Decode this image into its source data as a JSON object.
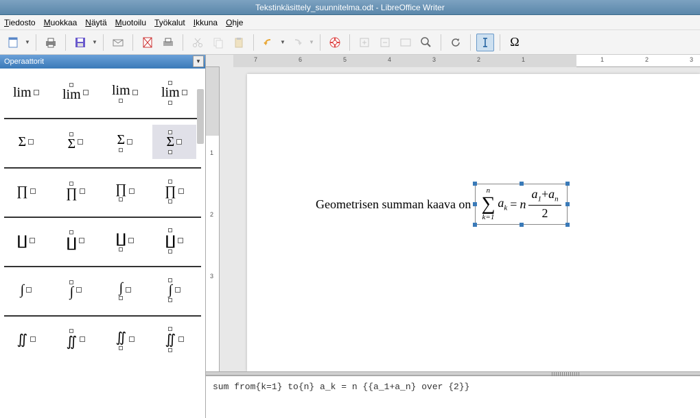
{
  "title": "Tekstinkäsittely_suunnitelma.odt - LibreOffice Writer",
  "menu": [
    "Tiedosto",
    "Muokkaa",
    "Näytä",
    "Muotoilu",
    "Työkalut",
    "Ikkuna",
    "Ohje"
  ],
  "elements_panel": {
    "title": "Operaattorit"
  },
  "element_rows": [
    [
      "lim",
      "lim",
      "lim",
      "lim"
    ],
    [
      "Σ",
      "Σ",
      "Σ",
      "Σ"
    ],
    [
      "∏",
      "∏",
      "∏",
      "∏"
    ],
    [
      "∐",
      "∐",
      "∐",
      "∐"
    ],
    [
      "∫",
      "∫",
      "∫",
      "∫"
    ],
    [
      "∬",
      "∬",
      "∬",
      "∬"
    ]
  ],
  "highlighted_element": {
    "row": 1,
    "col": 3
  },
  "ruler_numbers_left": [
    "7",
    "6",
    "5",
    "4",
    "3",
    "2",
    "1"
  ],
  "ruler_numbers_right": [
    "1",
    "2",
    "3"
  ],
  "vruler_labels": [
    "1",
    "2",
    "3"
  ],
  "doc_text": "Geometrisen summan kaava on",
  "formula": {
    "sigma_top": "n",
    "sigma_bottom": "k=1",
    "lhs": "a",
    "lhs_sub": "k",
    "eq": "=",
    "coef": "n",
    "num_a1": "a",
    "num_a1_sub": "1",
    "num_plus": "+",
    "num_an": "a",
    "num_an_sub": "n",
    "den": "2"
  },
  "command": "sum from{k=1} to{n} a_k = n {{a_1+a_n} over {2}}",
  "omega": "Ω"
}
